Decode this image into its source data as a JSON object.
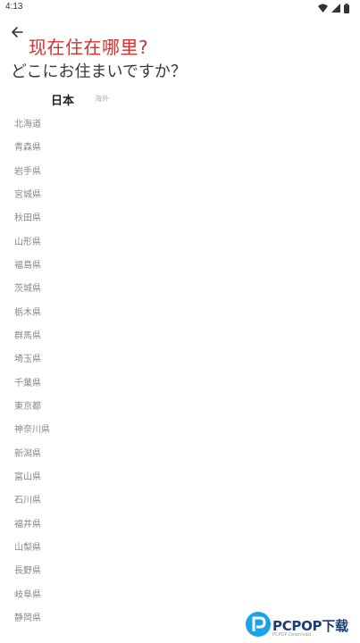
{
  "status_bar": {
    "time": "4:13"
  },
  "overlay_title": "现在住在哪里?",
  "page_question": "どこにお住まいですか？",
  "tabs": {
    "japan": "日本",
    "overseas": "海外"
  },
  "prefectures": [
    "北海道",
    "青森県",
    "岩手県",
    "宮城県",
    "秋田県",
    "山形県",
    "福島県",
    "茨城県",
    "栃木県",
    "群馬県",
    "埼玉県",
    "千葉県",
    "東京都",
    "神奈川県",
    "新潟県",
    "富山県",
    "石川県",
    "福井県",
    "山梨県",
    "長野県",
    "岐阜県",
    "静岡県"
  ],
  "watermark": {
    "brand": "PCPOP下载",
    "sub": "PCPOP Download"
  }
}
